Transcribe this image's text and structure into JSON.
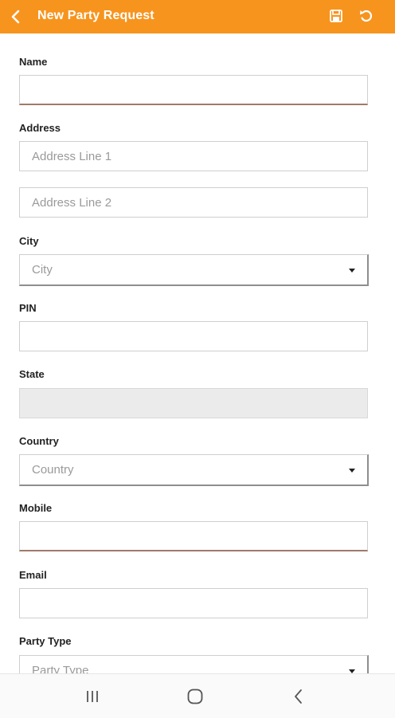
{
  "header": {
    "title": "New Party Request"
  },
  "icons": {
    "back": "chevron-left-icon",
    "save": "save-icon",
    "undo": "undo-icon",
    "recents": "recents-icon",
    "home": "home-icon",
    "nav_back": "nav-back-icon"
  },
  "colors": {
    "accent": "#f7941e"
  },
  "form": {
    "name_label": "Name",
    "name_value": "",
    "address_label": "Address",
    "address1_placeholder": "Address Line 1",
    "address2_placeholder": "Address Line 2",
    "city_label": "City",
    "city_placeholder": "City",
    "pin_label": "PIN",
    "pin_value": "",
    "state_label": "State",
    "state_value": "",
    "country_label": "Country",
    "country_placeholder": "Country",
    "mobile_label": "Mobile",
    "mobile_value": "",
    "email_label": "Email",
    "email_value": "",
    "party_type_label": "Party Type",
    "party_type_placeholder": "Party Type"
  }
}
